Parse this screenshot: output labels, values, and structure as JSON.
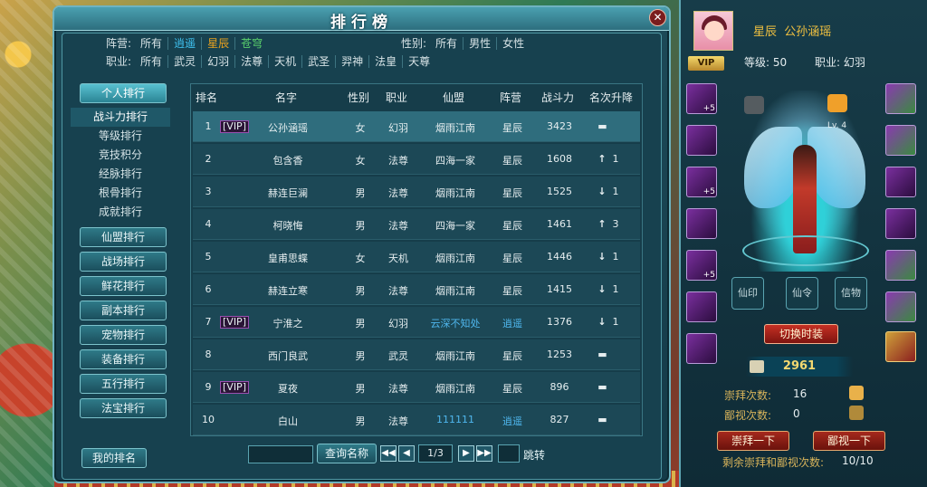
{
  "window": {
    "title": "排行榜"
  },
  "filters": {
    "camp_label": "阵营:",
    "camps": [
      "所有",
      "逍遥",
      "星辰",
      "苍穹"
    ],
    "gender_label": "性别:",
    "genders": [
      "所有",
      "男性",
      "女性"
    ],
    "job_label": "职业:",
    "jobs": [
      "所有",
      "武灵",
      "幻羽",
      "法尊",
      "天机",
      "武圣",
      "羿神",
      "法皇",
      "天尊"
    ]
  },
  "nav": {
    "personal": "个人排行",
    "sub": [
      "战斗力排行",
      "等级排行",
      "竞技积分",
      "经脉排行",
      "根骨排行",
      "成就排行"
    ],
    "categories": [
      "仙盟排行",
      "战场排行",
      "鲜花排行",
      "副本排行",
      "宠物排行",
      "装备排行",
      "五行排行",
      "法宝排行"
    ],
    "my_rank": "我的排名"
  },
  "table": {
    "headers": [
      "排名",
      "名字",
      "性别",
      "职业",
      "仙盟",
      "阵营",
      "战斗力",
      "名次升降"
    ],
    "rows": [
      {
        "rank": "1",
        "vip": "[VIP]",
        "name": "公孙涵瑶",
        "gender": "女",
        "job": "幻羽",
        "guild": "烟雨江南",
        "camp": "星辰",
        "power": "3423",
        "trend": "flat",
        "arrow": "▬",
        "change": ""
      },
      {
        "rank": "2",
        "vip": "",
        "name": "包含香",
        "gender": "女",
        "job": "法尊",
        "guild": "四海一家",
        "camp": "星辰",
        "power": "1608",
        "trend": "up",
        "arrow": "↑",
        "change": "1"
      },
      {
        "rank": "3",
        "vip": "",
        "name": "赫连巨澜",
        "gender": "男",
        "job": "法尊",
        "guild": "烟雨江南",
        "camp": "星辰",
        "power": "1525",
        "trend": "down",
        "arrow": "↓",
        "change": "1"
      },
      {
        "rank": "4",
        "vip": "",
        "name": "柯晓悔",
        "gender": "男",
        "job": "法尊",
        "guild": "四海一家",
        "camp": "星辰",
        "power": "1461",
        "trend": "up",
        "arrow": "↑",
        "change": "3"
      },
      {
        "rank": "5",
        "vip": "",
        "name": "皇甫思蝶",
        "gender": "女",
        "job": "天机",
        "guild": "烟雨江南",
        "camp": "星辰",
        "power": "1446",
        "trend": "down",
        "arrow": "↓",
        "change": "1"
      },
      {
        "rank": "6",
        "vip": "",
        "name": "赫连立寒",
        "gender": "男",
        "job": "法尊",
        "guild": "烟雨江南",
        "camp": "星辰",
        "power": "1415",
        "trend": "down",
        "arrow": "↓",
        "change": "1"
      },
      {
        "rank": "7",
        "vip": "[VIP]",
        "name": "宁淮之",
        "gender": "男",
        "job": "幻羽",
        "guild": "云深不知处",
        "camp": "逍遥",
        "power": "1376",
        "trend": "down",
        "arrow": "↓",
        "change": "1"
      },
      {
        "rank": "8",
        "vip": "",
        "name": "西门良武",
        "gender": "男",
        "job": "武灵",
        "guild": "烟雨江南",
        "camp": "星辰",
        "power": "1253",
        "trend": "flat",
        "arrow": "▬",
        "change": ""
      },
      {
        "rank": "9",
        "vip": "[VIP]",
        "name": "夏夜",
        "gender": "男",
        "job": "法尊",
        "guild": "烟雨江南",
        "camp": "星辰",
        "power": "896",
        "trend": "flat",
        "arrow": "▬",
        "change": ""
      },
      {
        "rank": "10",
        "vip": "",
        "name": "白山",
        "gender": "男",
        "job": "法尊",
        "guild": "111111",
        "camp": "逍遥",
        "power": "827",
        "trend": "flat",
        "arrow": "▬",
        "change": ""
      }
    ]
  },
  "pager": {
    "search_button": "查询名称",
    "page": "1/3",
    "jump": "跳转",
    "first": "◀◀",
    "prev": "◀",
    "next": "▶",
    "last": "▶▶"
  },
  "character": {
    "camp": "星辰",
    "name": "公孙涵瑶",
    "vip": "VIP",
    "level_label": "等级:",
    "level": "50",
    "job_label": "职业:",
    "job": "幻羽",
    "slot_plus": "+5",
    "weapon_level": "Lv. 4",
    "ornaments": [
      "仙印",
      "仙令",
      "信物"
    ],
    "switch_outfit": "切换时装",
    "power": "2961",
    "worship_label": "崇拜次数:",
    "worship": "16",
    "despise_label": "鄙视次数:",
    "despise": "0",
    "worship_button": "崇拜一下",
    "despise_button": "鄙视一下",
    "remaining_label": "剩余崇拜和鄙视次数:",
    "remaining": "10/10"
  },
  "colors": {
    "accent": "#2f6d7d",
    "guild_gold": "#e9a21e",
    "guild_blue": "#4fb7ee",
    "up": "#5ad06c",
    "down": "#ef3b3b",
    "vip": "#e27bf0"
  }
}
